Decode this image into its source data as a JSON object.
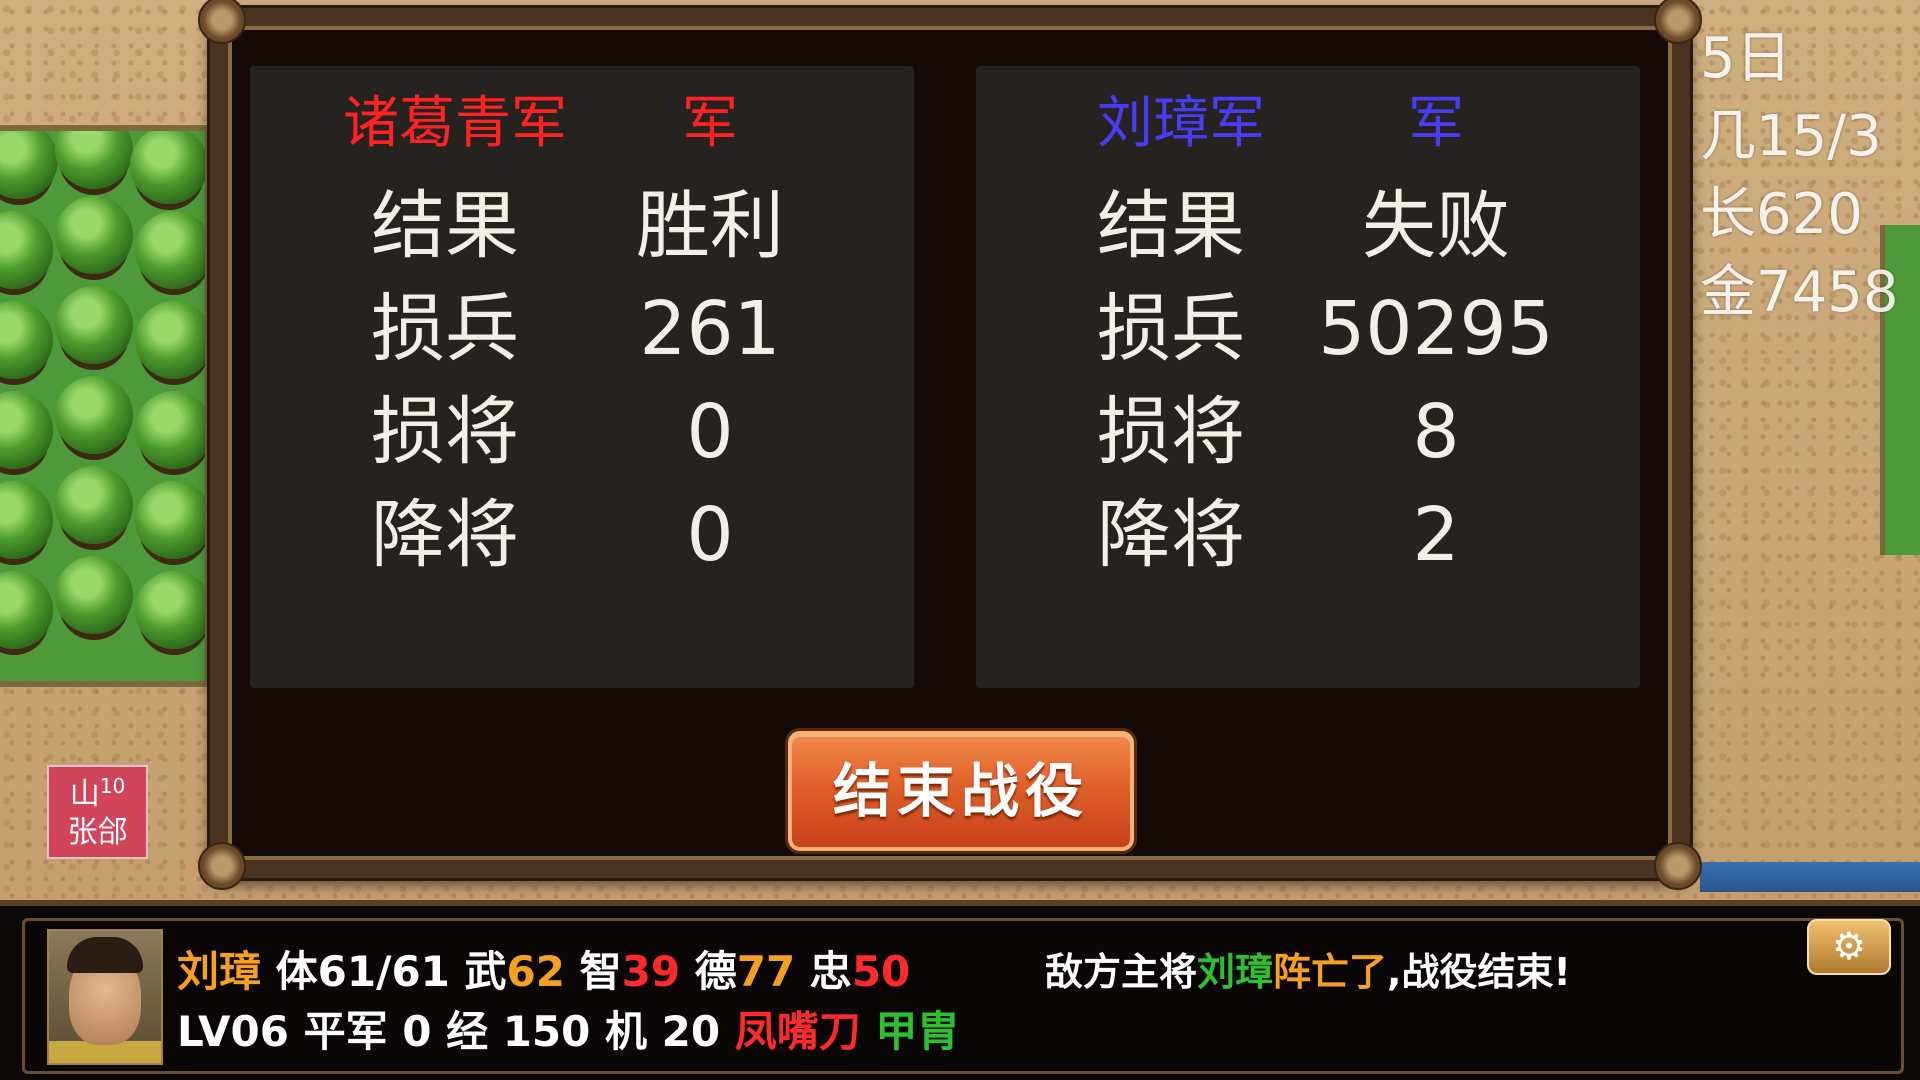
{
  "map": {
    "side_info": [
      "5日",
      "几15/3",
      "长620",
      "金7458"
    ],
    "city_marker": {
      "terrain": "山",
      "level": "10",
      "name": "张郃"
    }
  },
  "result": {
    "left": {
      "army_name": "诸葛青军",
      "army_suffix": "军",
      "name_color": "#ff2222",
      "stats": [
        {
          "label": "结果",
          "value": "胜利"
        },
        {
          "label": "损兵",
          "value": "261"
        },
        {
          "label": "损将",
          "value": "0"
        },
        {
          "label": "降将",
          "value": "0"
        }
      ]
    },
    "right": {
      "army_name": "刘璋军",
      "army_suffix": "军",
      "name_color": "#4a3cf5",
      "stats": [
        {
          "label": "结果",
          "value": "失败"
        },
        {
          "label": "损兵",
          "value": "50295"
        },
        {
          "label": "损将",
          "value": "8"
        },
        {
          "label": "降将",
          "value": "2"
        }
      ]
    },
    "end_button_label": "结束战役"
  },
  "status": {
    "general_name": "刘璋",
    "hp_label": "体",
    "hp": "61/61",
    "war_label": "武",
    "war": "62",
    "int_label": "智",
    "int": "39",
    "virtue_label": "德",
    "virtue": "77",
    "loyalty_label": "忠",
    "loyalty": "50",
    "level": "LV06",
    "troop_type": "平军",
    "troop_value": "0",
    "exp_label": "经",
    "exp": "150",
    "mobility_label": "机",
    "mobility": "20",
    "weapon": "凤嘴刀",
    "armor": "甲胄",
    "message_prefix": "敌方主将",
    "message_name": "刘璋",
    "message_event": "阵亡了",
    "message_suffix": ",战役结束!",
    "settings_icon": "gear-icon"
  }
}
